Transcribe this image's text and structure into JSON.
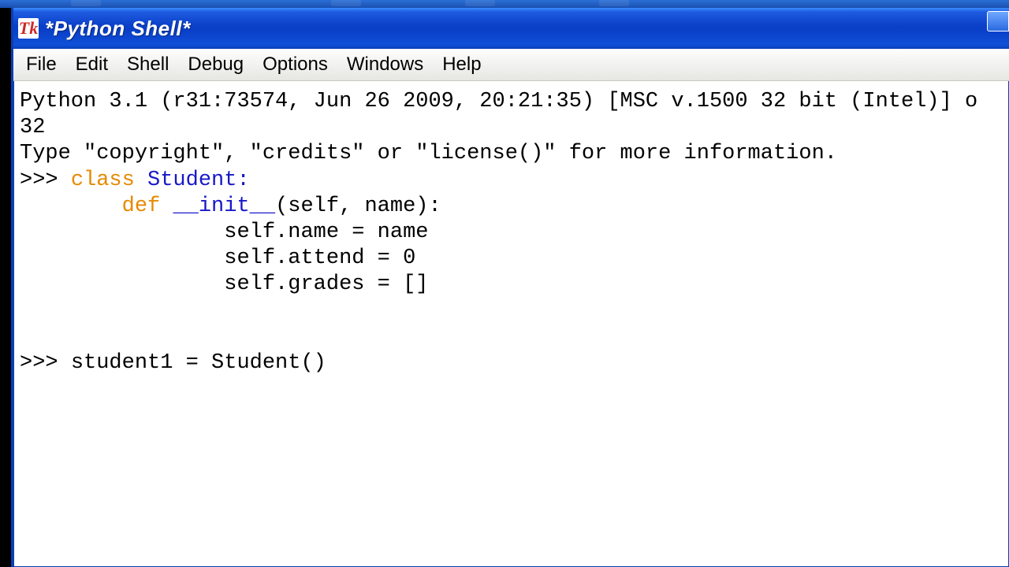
{
  "window": {
    "icon_text": "Tk",
    "title": "*Python Shell*"
  },
  "menu": {
    "file": "File",
    "edit": "Edit",
    "shell": "Shell",
    "debug": "Debug",
    "options": "Options",
    "windows": "Windows",
    "help": "Help"
  },
  "shell": {
    "banner_line1": "Python 3.1 (r31:73574, Jun 26 2009, 20:21:35) [MSC v.1500 32 bit (Intel)] o",
    "banner_line2": "32",
    "banner_line3": "Type \"copyright\", \"credits\" or \"license()\" for more information.",
    "prompt": ">>> ",
    "kw_class": "class",
    "class_rest": " Student:",
    "indent1": "        ",
    "kw_def": "def",
    "init_space": " ",
    "init_name": "__init__",
    "init_sig": "(self, name):",
    "indent2": "                ",
    "body1": "self.name = name",
    "body2": "self.attend = 0",
    "body3": "self.grades = []",
    "blank": "",
    "line_student1": "student1 = Student()"
  }
}
